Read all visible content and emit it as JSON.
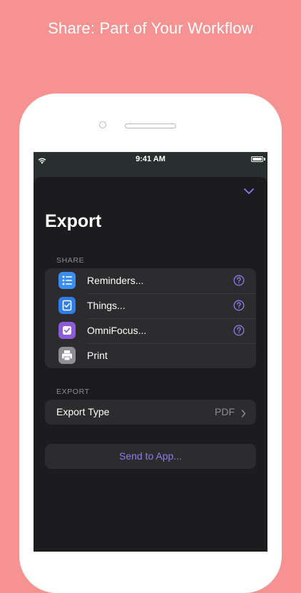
{
  "headline": "Share: Part of Your Workflow",
  "status_bar": {
    "time": "9:41 AM"
  },
  "sheet": {
    "title": "Export",
    "share_section": {
      "header": "SHARE",
      "items": [
        {
          "label": "Reminders...",
          "icon": "reminders-icon"
        },
        {
          "label": "Things...",
          "icon": "things-icon"
        },
        {
          "label": "OmniFocus...",
          "icon": "omnifocus-icon"
        },
        {
          "label": "Print",
          "icon": "print-icon"
        }
      ]
    },
    "export_section": {
      "header": "EXPORT",
      "export_type_label": "Export Type",
      "export_type_value": "PDF"
    },
    "send_button_label": "Send to App..."
  },
  "colors": {
    "background": "#f79292",
    "accent": "#8a7cf0",
    "reminders": "#3b8df2",
    "things": "#2f7de6",
    "omnifocus": "#8d5ad8",
    "print": "#8e8e93"
  }
}
